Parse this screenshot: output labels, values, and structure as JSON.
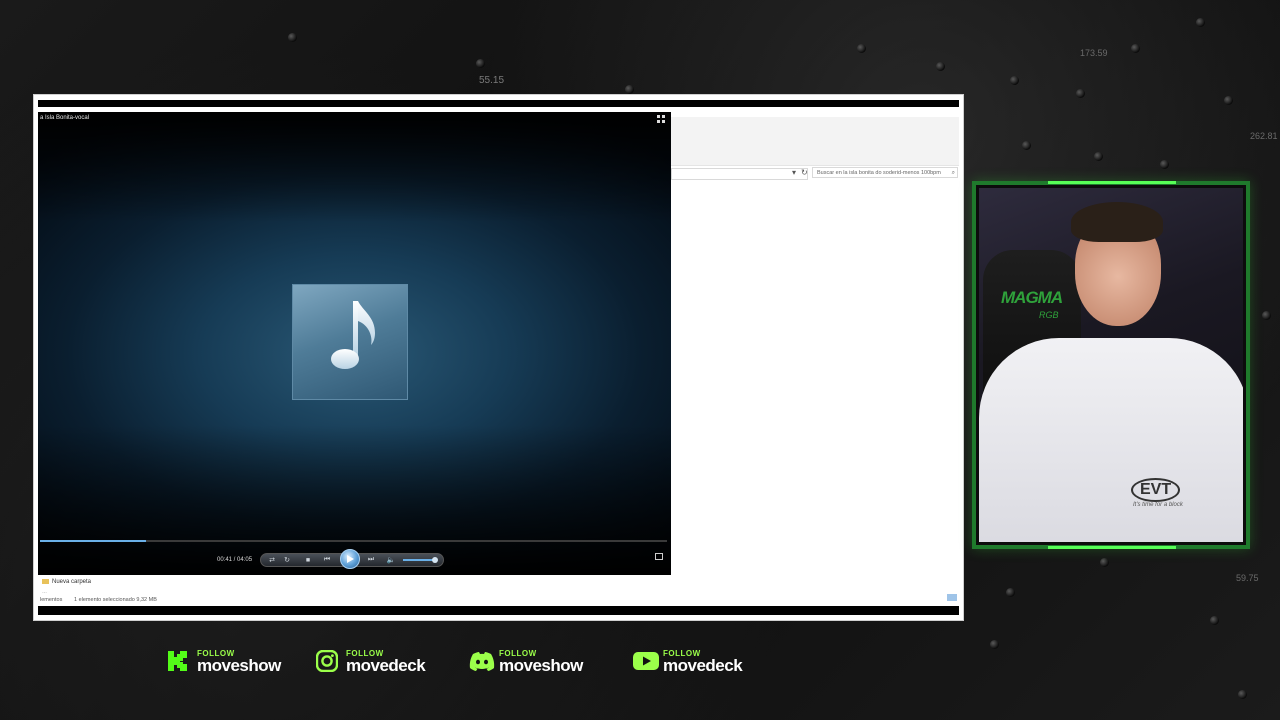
{
  "background": {
    "numbers": [
      "55.15",
      "59.75",
      "262.81",
      "173.59"
    ]
  },
  "explorer": {
    "search_placeholder": "Buscar en la isla bonita do soderid-menos 100bpm",
    "nav_folder": "Nueva carpeta",
    "nav_next": "…",
    "status_left": "lementos",
    "status_right": "1 elemento seleccionado  9,32 MB"
  },
  "player": {
    "title": "a Isla Bonita-vocal",
    "time": "00:41 / 04:05",
    "progress": 0.169,
    "volume": 0.9,
    "colors": {
      "accent": "#6ab0e8",
      "play_button": "#5c9ed6"
    },
    "icons": [
      "switch-to-library-icon",
      "shuffle-icon",
      "repeat-icon",
      "stop-icon",
      "previous-icon",
      "play-icon",
      "next-icon",
      "volume-icon",
      "fullscreen-icon",
      "music-note-icon"
    ]
  },
  "webcam": {
    "chair_logo": "MAGMA",
    "chair_sub": "RGB",
    "shirt_logo": "EVT",
    "shirt_tag": "It's time for a block"
  },
  "social": [
    {
      "platform": "kick",
      "follow": "FOLLOW",
      "handle": "moveshow",
      "icon": "kick-icon",
      "color": "#53fc18"
    },
    {
      "platform": "instagram",
      "follow": "FOLLOW",
      "handle": "movedeck",
      "icon": "instagram-icon",
      "color": "#9bff4a"
    },
    {
      "platform": "discord",
      "follow": "FOLLOW",
      "handle": "moveshow",
      "icon": "discord-icon",
      "color": "#9bff4a"
    },
    {
      "platform": "youtube",
      "follow": "FOLLOW",
      "handle": "movedeck",
      "icon": "youtube-icon",
      "color": "#9bff4a"
    }
  ]
}
